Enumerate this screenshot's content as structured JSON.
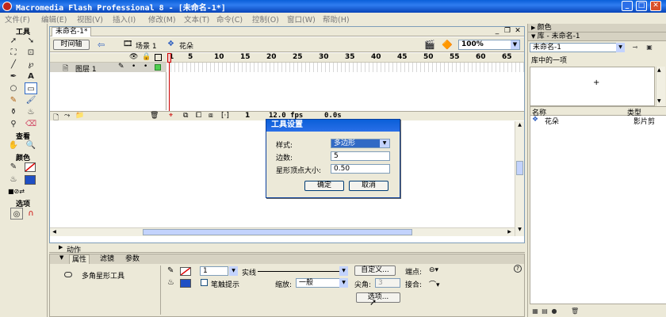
{
  "window": {
    "title": "Macromedia Flash Professional 8 - [未命名-1*]",
    "minimize": "_",
    "maximize": "□",
    "close": "✕"
  },
  "menu": [
    "文件(F)",
    "编辑(E)",
    "视图(V)",
    "插入(I)",
    "修改(M)",
    "文本(T)",
    "命令(C)",
    "控制(O)",
    "窗口(W)",
    "帮助(H)"
  ],
  "tools": {
    "title": "工具",
    "view_title": "查看",
    "colors_title": "颜色",
    "options_title": "选项",
    "items": [
      "arrow",
      "subselect",
      "free-transform",
      "fill-transform",
      "line",
      "lasso",
      "pen",
      "text",
      "oval",
      "polystar",
      "pencil",
      "brush",
      "ink-bottle",
      "paint-bucket",
      "eyedropper",
      "eraser"
    ]
  },
  "document": {
    "tab": "未命名-1*",
    "timeline_button": "时间轴",
    "scene_label": "场景 1",
    "symbol_label": "花朵",
    "zoom": "100%",
    "frame_numbers": [
      "1",
      "5",
      "10",
      "15",
      "20",
      "25",
      "30",
      "35",
      "40",
      "45",
      "50",
      "55",
      "60",
      "65"
    ],
    "layer_name": "图层 1",
    "current_frame": "1",
    "fps": "12.0 fps",
    "time": "0.0s"
  },
  "dialog": {
    "title": "工具设置",
    "style_label": "样式:",
    "style_value": "多边形",
    "sides_label": "边数:",
    "sides_value": "5",
    "star_label": "星形顶点大小:",
    "star_value": "0.50",
    "ok": "确定",
    "cancel": "取消"
  },
  "panels": {
    "actions": "动作",
    "tabs": [
      "属性",
      "滤镜",
      "参数"
    ],
    "tool_name": "多角星形工具",
    "stroke_width": "1",
    "stroke_style": "实线",
    "custom_button": "自定义...",
    "cap_label": "端点:",
    "stroke_hint": "笔触提示",
    "scale_label": "缩放:",
    "scale_value": "一般",
    "miter_label": "尖角:",
    "miter_value": "3",
    "join_label": "接合:",
    "options_button": "选项...",
    "help": "?"
  },
  "library": {
    "colors_header": "颜色",
    "header": "库 - 未命名-1",
    "doc_select": "未命名-1",
    "count": "库中的一项",
    "col_name": "名称",
    "col_type": "类型",
    "item_name": "花朵",
    "item_type": "影片剪"
  },
  "colors": {
    "accent": "#316ac5",
    "title_blue": "#0a5fd8",
    "playhead": "#cc0000",
    "panel_bg": "#ece9d8"
  }
}
